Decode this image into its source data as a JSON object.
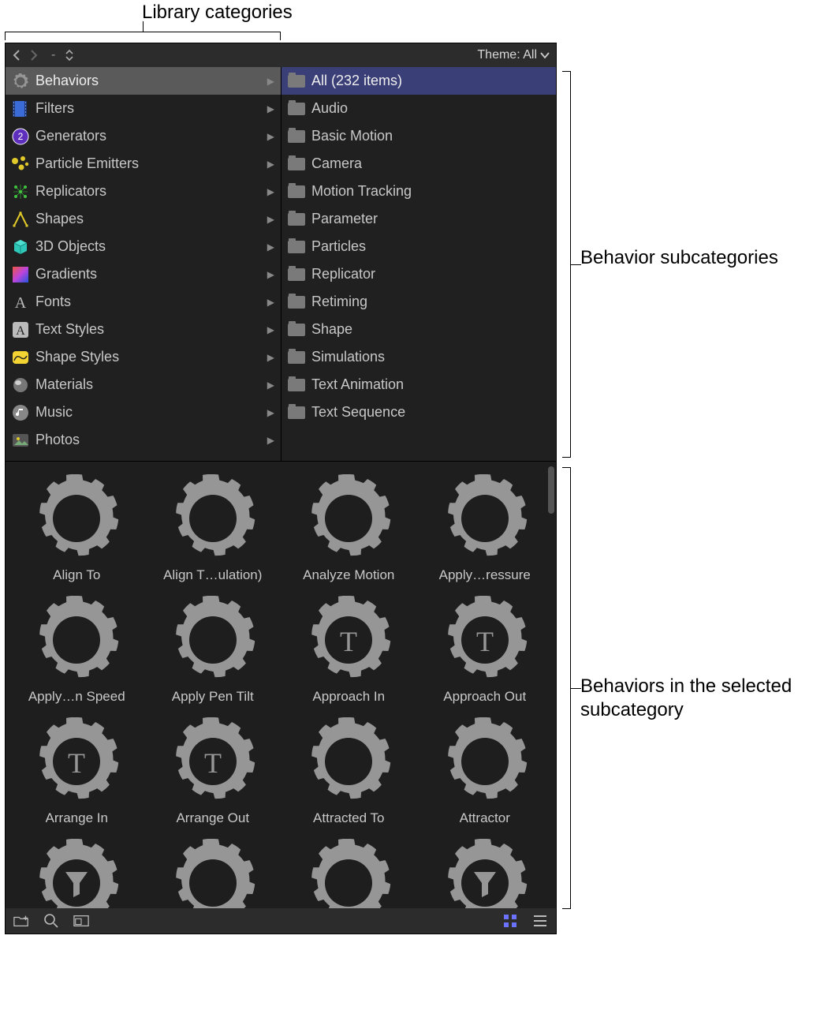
{
  "annotations": {
    "top": "Library categories",
    "right_upper": "Behavior subcategories",
    "right_lower": "Behaviors in the selected subcategory"
  },
  "toolbar": {
    "path_text": "-",
    "theme_label": "Theme: All"
  },
  "categories": [
    {
      "label": "Behaviors",
      "icon": "gear",
      "selected": true
    },
    {
      "label": "Filters",
      "icon": "filmstrip"
    },
    {
      "label": "Generators",
      "icon": "clock2"
    },
    {
      "label": "Particle Emitters",
      "icon": "particle"
    },
    {
      "label": "Replicators",
      "icon": "repl"
    },
    {
      "label": "Shapes",
      "icon": "shape"
    },
    {
      "label": "3D Objects",
      "icon": "cube3d"
    },
    {
      "label": "Gradients",
      "icon": "gradient"
    },
    {
      "label": "Fonts",
      "icon": "fontA"
    },
    {
      "label": "Text Styles",
      "icon": "fontAbox"
    },
    {
      "label": "Shape Styles",
      "icon": "shapestyle"
    },
    {
      "label": "Materials",
      "icon": "material"
    },
    {
      "label": "Music",
      "icon": "music"
    },
    {
      "label": "Photos",
      "icon": "photo"
    }
  ],
  "subcategories": [
    {
      "label": "All (232 items)",
      "selected": true
    },
    {
      "label": "Audio"
    },
    {
      "label": "Basic Motion"
    },
    {
      "label": "Camera"
    },
    {
      "label": "Motion Tracking"
    },
    {
      "label": "Parameter"
    },
    {
      "label": "Particles"
    },
    {
      "label": "Replicator"
    },
    {
      "label": "Retiming"
    },
    {
      "label": "Shape"
    },
    {
      "label": "Simulations"
    },
    {
      "label": "Text Animation"
    },
    {
      "label": "Text Sequence"
    }
  ],
  "behaviors": [
    {
      "label": "Align To",
      "icon": "gear"
    },
    {
      "label": "Align T…ulation)",
      "icon": "gear"
    },
    {
      "label": "Analyze Motion",
      "icon": "gear"
    },
    {
      "label": "Apply…ressure",
      "icon": "gear"
    },
    {
      "label": "Apply…n Speed",
      "icon": "gear"
    },
    {
      "label": "Apply Pen Tilt",
      "icon": "gear"
    },
    {
      "label": "Approach In",
      "icon": "gearT"
    },
    {
      "label": "Approach Out",
      "icon": "gearT"
    },
    {
      "label": "Arrange In",
      "icon": "gearT"
    },
    {
      "label": "Arrange Out",
      "icon": "gearT"
    },
    {
      "label": "Attracted To",
      "icon": "gear"
    },
    {
      "label": "Attractor",
      "icon": "gear"
    },
    {
      "label": "",
      "icon": "gearFunnel"
    },
    {
      "label": "",
      "icon": "gear"
    },
    {
      "label": "",
      "icon": "gear"
    },
    {
      "label": "",
      "icon": "gearFunnel"
    }
  ]
}
